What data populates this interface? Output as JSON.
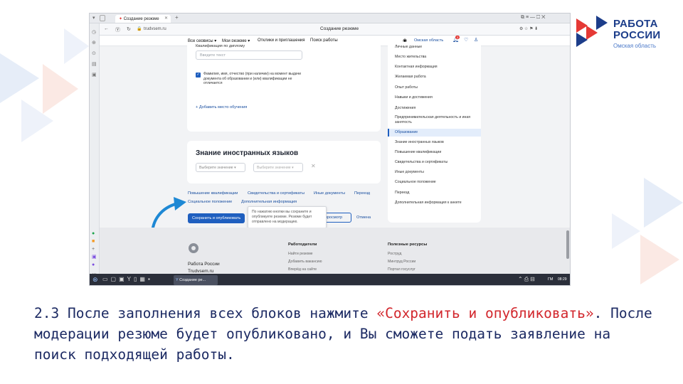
{
  "logo": {
    "line1": "РАБОТА",
    "line2": "РОССИИ",
    "region": "Омская область"
  },
  "browser": {
    "tab_title": "Создание резюме",
    "url": "trudvsem.ru",
    "page_title": "Создание резюме"
  },
  "sitenav": {
    "items": [
      "Все сервисы ▾",
      "Мои резюме ▾",
      "Отклики и приглашения",
      "Поиск работы"
    ],
    "region": "Омская область",
    "notif_count": "3"
  },
  "form": {
    "qual_label": "Квалификация по диплому",
    "qual_placeholder": "Введите текст",
    "checkbox_text": "Фамилия, имя, отчество (при наличии) на момент выдачи документа об образовании и (или) квалификации не отличается",
    "add_education": "+ Добавить место обучения",
    "lang_title": "Знание иностранных языков",
    "select1": "Выберите значение ▾",
    "select2": "Выберите значение ▾",
    "links_row1": [
      "Повышение квалификации",
      "Свидетельства и сертификаты",
      "Иные документы",
      "Переезд"
    ],
    "links_row2": [
      "Социальное положение",
      "Дополнительная информация"
    ],
    "save_button": "Сохранить и опубликовать",
    "preview_button": "просмотр",
    "cancel": "Отмена",
    "tooltip": "По нажатию кнопки вы сохраните и опубликуете резюме. Резюме будет отправлено на модерацию."
  },
  "sidebar": {
    "items": [
      "Личные данные",
      "Место жительства",
      "Контактная информация",
      "Желаемая работа",
      "Опыт работы",
      "Навыки и достижения",
      "Достижения",
      "Предпринимательская деятельность и иная занятость",
      "Образование",
      "Знание иностранных языков",
      "Повышение квалификации",
      "Свидетельства и сертификаты",
      "Иные документы",
      "Социальное положение",
      "Переезд",
      "Дополнительная информация к анкете"
    ],
    "active_index": 8
  },
  "footer": {
    "brand1": "Работа России",
    "brand2": "Trudvsem.ru",
    "col1_title": "Работодатели",
    "col1_items": [
      "Найти резюме",
      "Добавить вакансию",
      "Вперёд на сайте"
    ],
    "col2_title": "Полезные ресурсы",
    "col2_items": [
      "Роструд",
      "Минтруд России",
      "Портал госуслуг"
    ]
  },
  "taskbar": {
    "window_label": "Создание ре...",
    "lang": "ГМ",
    "time": "08:29"
  },
  "caption": {
    "part1": "2.3 После заполнения всех блоков нажмите ",
    "highlight": "«Сохранить и опубликовать»",
    "part2": ". После модерации резюме будет опубликовано, и Вы сможете подать заявление на поиск подходящей работы."
  },
  "colors": {
    "brand_blue": "#1c3d8a",
    "accent_red": "#d2262c",
    "button_blue": "#1f5fbf"
  }
}
